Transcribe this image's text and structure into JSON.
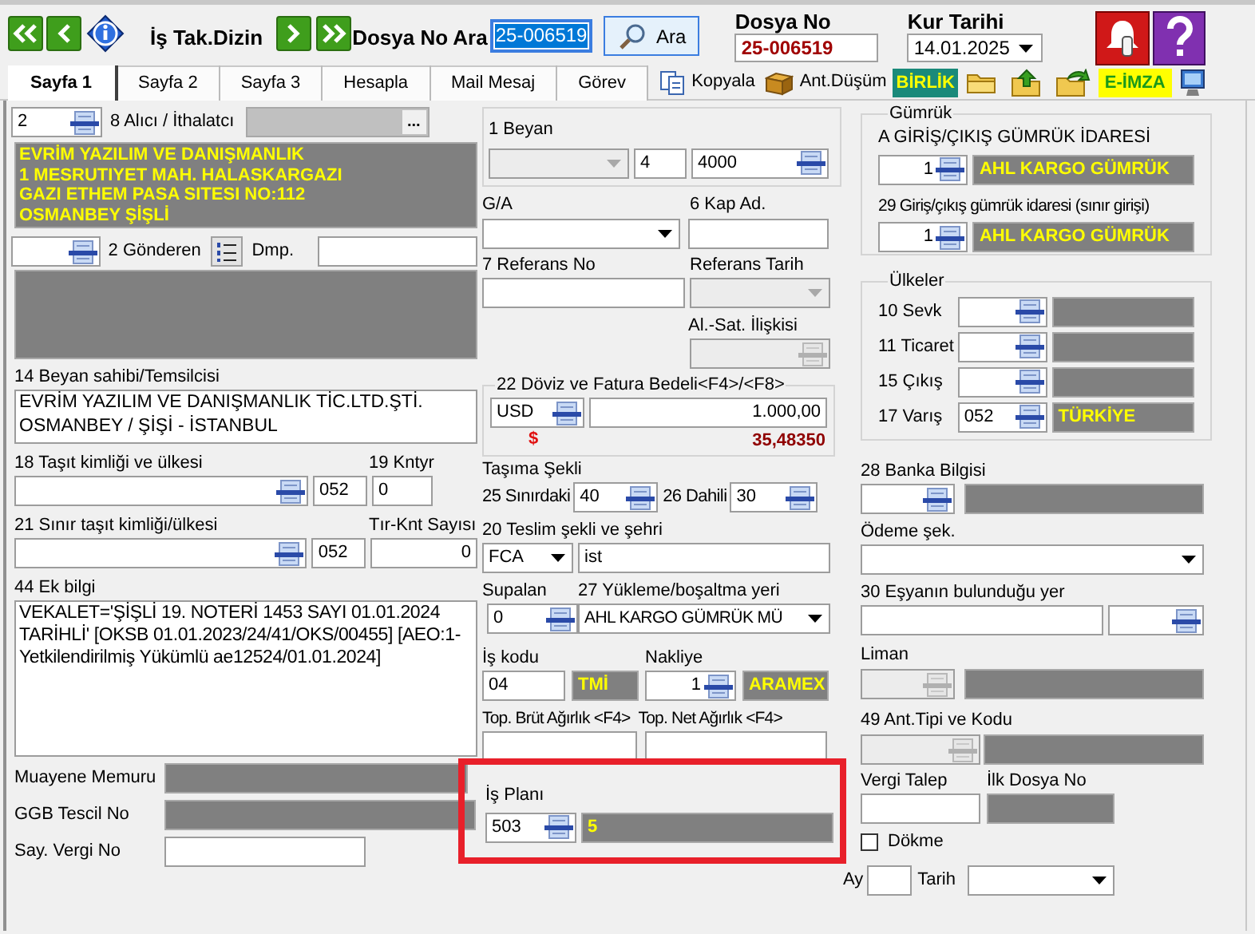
{
  "toolbar": {
    "title": "İş Tak.Dizin",
    "search_label": "Dosya No Ara",
    "search_value": "25-006519",
    "search_button": "Ara",
    "dosya_no_label": "Dosya No",
    "dosya_no": "25-006519",
    "kur_tarihi_label": "Kur Tarihi",
    "kur_tarihi": "14.01.2025"
  },
  "tabs": [
    {
      "label": "Sayfa 1",
      "selected": true
    },
    {
      "label": "Sayfa 2",
      "selected": false
    },
    {
      "label": "Sayfa 3",
      "selected": false
    },
    {
      "label": "Hesapla",
      "selected": false
    },
    {
      "label": "Mail Mesaj",
      "selected": false
    },
    {
      "label": "Görev",
      "selected": false
    }
  ],
  "tab_tools": [
    {
      "kind": "copy",
      "label": "Kopyala"
    },
    {
      "kind": "box",
      "label": "Ant.Düşüm"
    },
    {
      "kind": "badge",
      "label": "BİRLİK"
    },
    {
      "kind": "folder"
    },
    {
      "kind": "folder-up"
    },
    {
      "kind": "folder-arrow"
    },
    {
      "kind": "highlight",
      "label": "E-İMZA"
    },
    {
      "kind": "monitor"
    }
  ],
  "alici": {
    "code": "2",
    "label": "8 Alıcı / İthalatcı",
    "ellipsis": "...",
    "address_lines": [
      "EVRİM YAZILIM VE DANIŞMANLIK",
      "1 MESRUTIYET MAH. HALASKARGAZI",
      "GAZI ETHEM PASA SITESI NO:112",
      "OSMANBEY ŞİŞLİ"
    ]
  },
  "gonderen": {
    "label": "2 Gönderen",
    "dmp_label": "Dmp."
  },
  "beyan_sahibi": {
    "label": "14 Beyan sahibi/Temsilcisi",
    "lines": [
      "EVRİM YAZILIM VE DANIŞMANLIK TİC.LTD.ŞTİ.",
      "OSMANBEY / ŞİŞİ - İSTANBUL"
    ]
  },
  "tasit": {
    "label": "18 Taşıt kimliği ve ülkesi",
    "country": "052",
    "count_label": "19 Kntyr",
    "count": "0"
  },
  "sinir_tasit": {
    "label": "21 Sınır taşıt kimliği/ülkesi",
    "country": "052",
    "count_label": "Tır-Knt Sayısı",
    "count": "0"
  },
  "ek_bilgi": {
    "label": "44 Ek bilgi",
    "lines": [
      "VEKALET='ŞİŞLİ 19. NOTERİ 1453 SAYI 01.01.2024",
      "TARİHLİ' [OKSB 01.01.2023/24/41/OKS/00455] [AEO:1-",
      "Yetkilendirilmiş Yükümlü ae12524/01.01.2024]"
    ]
  },
  "officials": [
    {
      "label": "Muayene Memuru",
      "kind": "readonly"
    },
    {
      "label": "GGB Tescil No",
      "kind": "readonly"
    },
    {
      "label": "Say. Vergi No",
      "kind": "input"
    }
  ],
  "beyan": {
    "label": "1 Beyan",
    "code": "4",
    "number": "4000"
  },
  "ga": {
    "label": "G/A"
  },
  "kap": {
    "label": "6 Kap Ad."
  },
  "referans_no": {
    "label": "7 Referans No"
  },
  "referans_tarih": {
    "label": "Referans Tarih"
  },
  "al_sat": {
    "label": "Al.-Sat. İlişkisi"
  },
  "doviz": {
    "label": "22 Döviz ve Fatura Bedeli<F4>/<F8>",
    "currency": "USD",
    "amount": "1.000,00",
    "symbol": "$",
    "rate": "35,48350"
  },
  "tasima": {
    "label": "Taşıma Şekli",
    "sinir_label": "25 Sınırdaki",
    "sinir": "40",
    "dahili_label": "26 Dahili",
    "dahili": "30"
  },
  "teslim": {
    "label": "20 Teslim şekli ve şehri",
    "term": "FCA",
    "city": "ist"
  },
  "supalan": {
    "label": "Supalan",
    "value": "0"
  },
  "yukleme": {
    "label": "27 Yükleme/boşaltma yeri",
    "value": "AHL KARGO GÜMRÜK MÜ"
  },
  "is_kodu": {
    "label": "İş kodu",
    "code": "04",
    "name": "TMİ"
  },
  "nakliye": {
    "label": "Nakliye",
    "code": "1",
    "name": "ARAMEX"
  },
  "agirlik": [
    {
      "label": "Top. Brüt Ağırlık <F4>"
    },
    {
      "label": "Top. Net Ağırlık <F4>"
    }
  ],
  "is_plani": {
    "label": "İş Planı",
    "code": "503",
    "name": "5"
  },
  "gumruk": {
    "title": "Gümrük",
    "offices": [
      {
        "label": "A GİRİŞ/ÇIKIŞ GÜMRÜK İDARESİ",
        "code": "1",
        "name": "AHL KARGO GÜMRÜK"
      },
      {
        "label": "29 Giriş/çıkış gümrük idaresi (sınır girişi)",
        "code": "1",
        "name": "AHL KARGO GÜMRÜK"
      }
    ]
  },
  "ulkeler": {
    "title": "Ülkeler",
    "rows": [
      {
        "label": "10 Sevk"
      },
      {
        "label": "11 Ticaret"
      },
      {
        "label": "15 Çıkış"
      },
      {
        "label": "17 Varış",
        "code": "052",
        "name": "TÜRKİYE"
      }
    ]
  },
  "banka": {
    "label": "28 Banka Bilgisi"
  },
  "odeme": {
    "label": "Ödeme şek."
  },
  "esya_yeri": {
    "label": "30 Eşyanın bulunduğu yer"
  },
  "liman": {
    "label": "Liman"
  },
  "ant_tipi": {
    "label": "49 Ant.Tipi ve Kodu"
  },
  "vergi_talep": {
    "label": "Vergi Talep"
  },
  "ilk_dosya": {
    "label": "İlk Dosya No"
  },
  "dokme": {
    "label": "Dökme",
    "checked": false
  },
  "ay": {
    "label": "Ay"
  },
  "tarih": {
    "label": "Tarih"
  }
}
